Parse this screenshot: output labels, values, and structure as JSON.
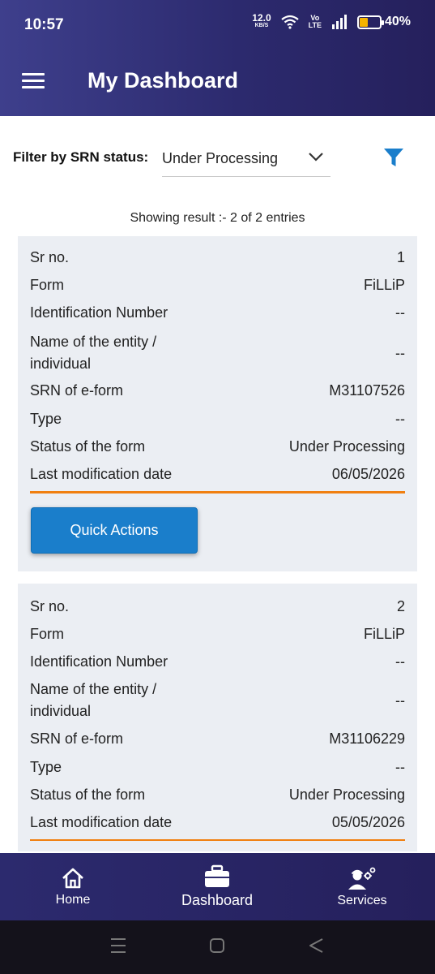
{
  "status_bar": {
    "time": "10:57",
    "speed_value": "12.0",
    "speed_unit": "KB/S",
    "volte_top": "Vo",
    "volte_bottom": "LTE",
    "battery": "40%"
  },
  "header": {
    "title": "My Dashboard",
    "menu_icon": "hamburger-menu-icon"
  },
  "filter": {
    "label": "Filter by SRN status:",
    "selected": "Under Processing",
    "filter_icon": "funnel-icon"
  },
  "results_text": "Showing result :- 2 of 2 entries",
  "records": [
    {
      "fields": [
        {
          "label": "Sr no.",
          "value": "1"
        },
        {
          "label": "Form",
          "value": "FiLLiP"
        },
        {
          "label": "Identification Number",
          "value": "--"
        },
        {
          "label": "Name of the entity / individual",
          "value": "--"
        },
        {
          "label": "SRN of e-form",
          "value": "M31107526"
        },
        {
          "label": "Type",
          "value": "--"
        },
        {
          "label": "Status of the form",
          "value": "Under Processing"
        },
        {
          "label": "Last modification date",
          "value": "06/05/2026"
        }
      ],
      "action_label": "Quick Actions"
    },
    {
      "fields": [
        {
          "label": "Sr no.",
          "value": "2"
        },
        {
          "label": "Form",
          "value": "FiLLiP"
        },
        {
          "label": "Identification Number",
          "value": "--"
        },
        {
          "label": "Name of the entity / individual",
          "value": "--"
        },
        {
          "label": "SRN of e-form",
          "value": "M31106229"
        },
        {
          "label": "Type",
          "value": "--"
        },
        {
          "label": "Status of the form",
          "value": "Under Processing"
        },
        {
          "label": "Last modification date",
          "value": "05/05/2026"
        }
      ]
    }
  ],
  "bottom_nav": [
    {
      "label": "Home",
      "icon": "home-icon"
    },
    {
      "label": "Dashboard",
      "icon": "briefcase-icon"
    },
    {
      "label": "Services",
      "icon": "services-icon"
    }
  ],
  "colors": {
    "header": "#2c2a6e",
    "accent": "#f07f10",
    "button": "#1a7ecb",
    "card": "#ebeef3",
    "filter_icon": "#1a7ecb"
  }
}
